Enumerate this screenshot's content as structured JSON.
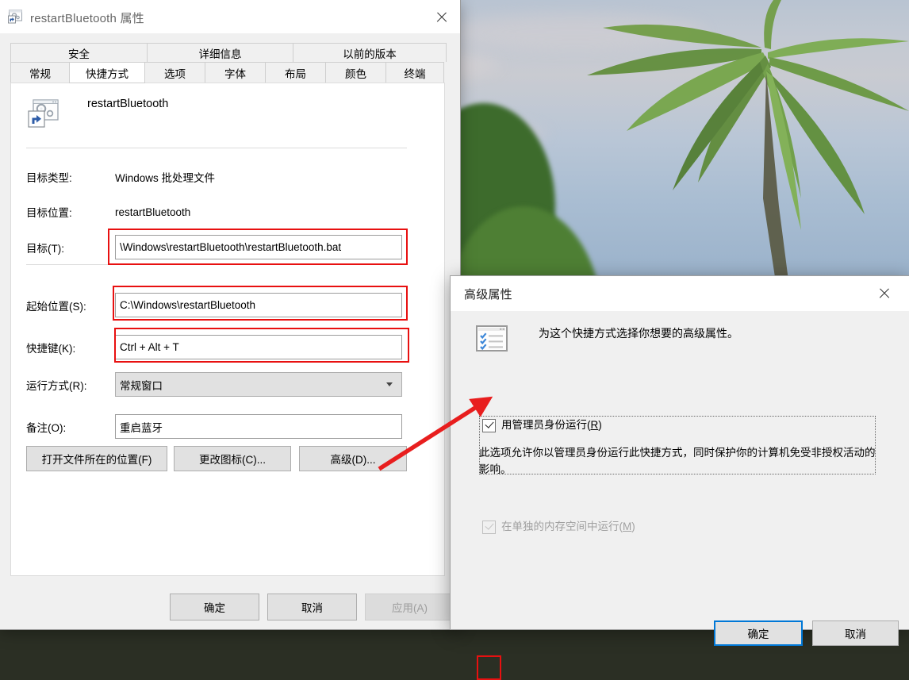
{
  "properties_dialog": {
    "title": "restartBluetooth 属性",
    "title_icon": "batch-file-shortcut-icon",
    "close_icon": "close-icon",
    "tabs_top": [
      {
        "label": "安全"
      },
      {
        "label": "详细信息"
      },
      {
        "label": "以前的版本"
      }
    ],
    "tabs_bottom": [
      {
        "label": "常规",
        "active": false
      },
      {
        "label": "快捷方式",
        "active": true
      },
      {
        "label": "选项",
        "active": false
      },
      {
        "label": "字体",
        "active": false
      },
      {
        "label": "布局",
        "active": false
      },
      {
        "label": "颜色",
        "active": false
      },
      {
        "label": "终端",
        "active": false
      }
    ],
    "shortcut_name": "restartBluetooth",
    "fields": [
      {
        "label": "目标类型:",
        "value": "Windows 批处理文件",
        "kind": "static"
      },
      {
        "label": "目标位置:",
        "value": "restartBluetooth",
        "kind": "static"
      },
      {
        "label": "目标(T):",
        "value": "\\Windows\\restartBluetooth\\restartBluetooth.bat",
        "kind": "text",
        "highlighted": true
      },
      {
        "label": "起始位置(S):",
        "value": "C:\\Windows\\restartBluetooth",
        "kind": "text",
        "highlighted": true
      },
      {
        "label": "快捷键(K):",
        "value": "Ctrl + Alt + T",
        "kind": "text",
        "highlighted": true
      },
      {
        "label": "运行方式(R):",
        "value": "常规窗口",
        "kind": "combo",
        "highlighted": false
      },
      {
        "label": "备注(O):",
        "value": "重启蓝牙",
        "kind": "text",
        "highlighted": false
      }
    ],
    "action_buttons": [
      {
        "label": "打开文件所在的位置(F)"
      },
      {
        "label": "更改图标(C)..."
      },
      {
        "label": "高级(D)..."
      }
    ],
    "footer_buttons": [
      {
        "label": "确定",
        "disabled": false
      },
      {
        "label": "取消",
        "disabled": false
      },
      {
        "label": "应用(A)",
        "disabled": true
      }
    ]
  },
  "advanced_dialog": {
    "title": "高级属性",
    "close_icon": "close-icon",
    "header_icon": "checklist-properties-icon",
    "header_text": "为这个快捷方式选择你想要的高级属性。",
    "run_as_admin": {
      "label_prefix": "用管理员身份运行(",
      "label_accel": "R",
      "label_suffix": ")",
      "checked": true,
      "disabled": false,
      "highlighted": true
    },
    "description": "此选项允许你以管理员身份运行此快捷方式，同时保护你的计算机免受非授权活动的影响。",
    "separate_memory": {
      "label_prefix": "在单独的内存空间中运行(",
      "label_accel": "M",
      "label_suffix": ")",
      "checked": true,
      "disabled": true
    },
    "footer_buttons": [
      {
        "label": "确定",
        "focused": true
      },
      {
        "label": "取消",
        "focused": false
      }
    ]
  },
  "annotations": {
    "highlight_color": "#e81010",
    "arrow_color": "#e81e1e",
    "arrow_name": "red-pointer-arrow"
  },
  "desktop": {
    "wallpaper_name": "tropical-beach-rocks-palm-wallpaper"
  }
}
